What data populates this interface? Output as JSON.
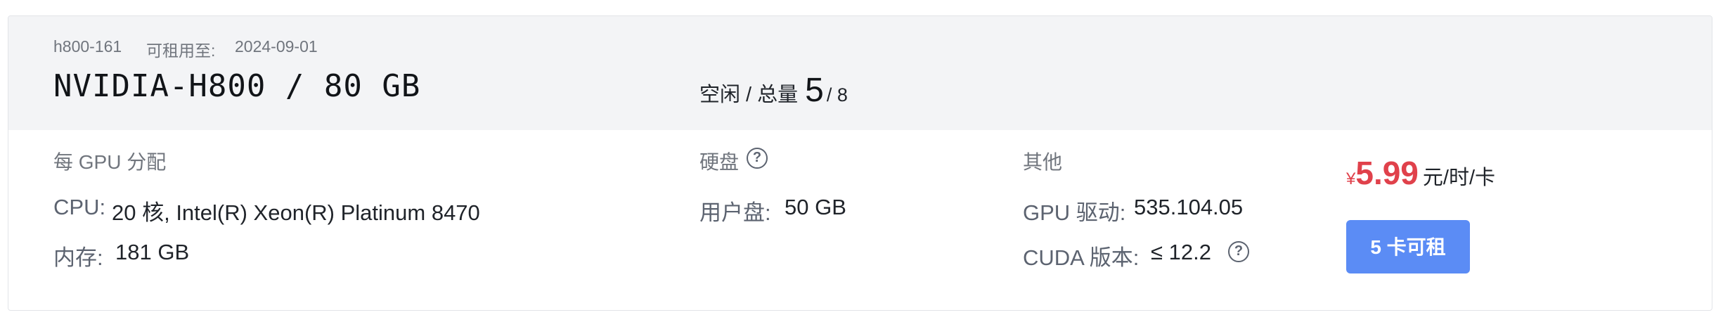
{
  "header": {
    "instance_id": "h800-161",
    "available_until_label": "可租用至:",
    "available_until_date": "2024-09-01",
    "gpu_model": "NVIDIA-H800 / 80 GB",
    "idle_label": "空闲 / 总量",
    "idle_count": "5",
    "total_count": "/ 8"
  },
  "per_gpu": {
    "title": "每 GPU 分配",
    "cpu_label": "CPU:",
    "cpu_value": "20 核, Intel(R) Xeon(R) Platinum 8470",
    "memory_label": "内存:",
    "memory_value": "181 GB"
  },
  "disk": {
    "title": "硬盘",
    "user_disk_label": "用户盘:",
    "user_disk_value": "50 GB"
  },
  "other": {
    "title": "其他",
    "driver_label": "GPU 驱动:",
    "driver_value": "535.104.05",
    "cuda_label": "CUDA 版本:",
    "cuda_value": "≤ 12.2"
  },
  "pricing": {
    "currency": "¥",
    "price": "5.99",
    "unit": "元/时/卡",
    "rent_button": "5 卡可租"
  },
  "icons": {
    "help": "question-circle-icon"
  },
  "colors": {
    "price": "#e0414b",
    "button": "#5b8cf5",
    "header_bg": "#f3f4f6"
  }
}
